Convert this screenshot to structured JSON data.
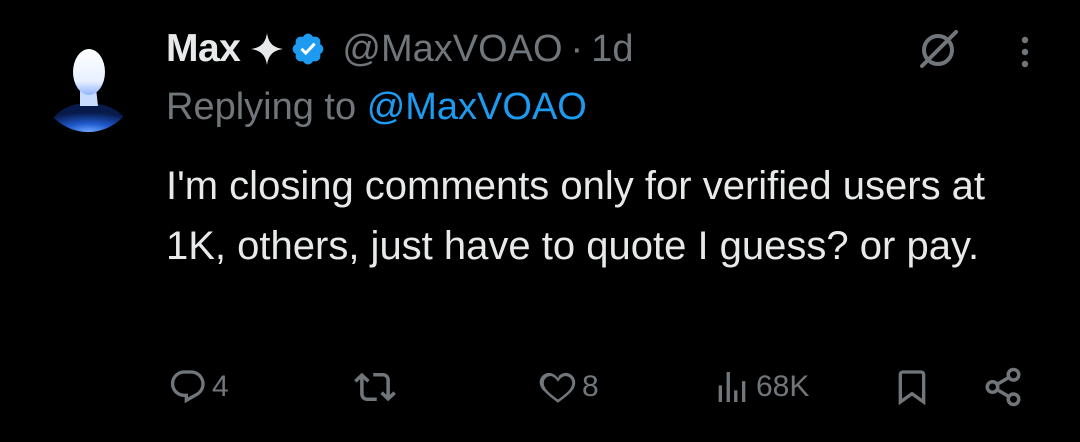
{
  "author": {
    "name": "Max",
    "handle": "@MaxVOAO",
    "separator": "·",
    "time": "1d",
    "avatar_icon": "profile-silhouette-icon",
    "badge_icons": [
      "sparkle-icon",
      "verified-badge-icon"
    ]
  },
  "reply": {
    "prefix": "Replying to",
    "mention": "@MaxVOAO"
  },
  "tweet": {
    "text": "I'm closing comments only for verified users at 1K, others, just have to quote I guess? or pay."
  },
  "actions": {
    "replies": "4",
    "retweets": "",
    "likes": "8",
    "views": "68K"
  },
  "colors": {
    "background": "#000000",
    "text": "#e7e9ea",
    "muted": "#71767b",
    "accent": "#1d9bf0"
  }
}
